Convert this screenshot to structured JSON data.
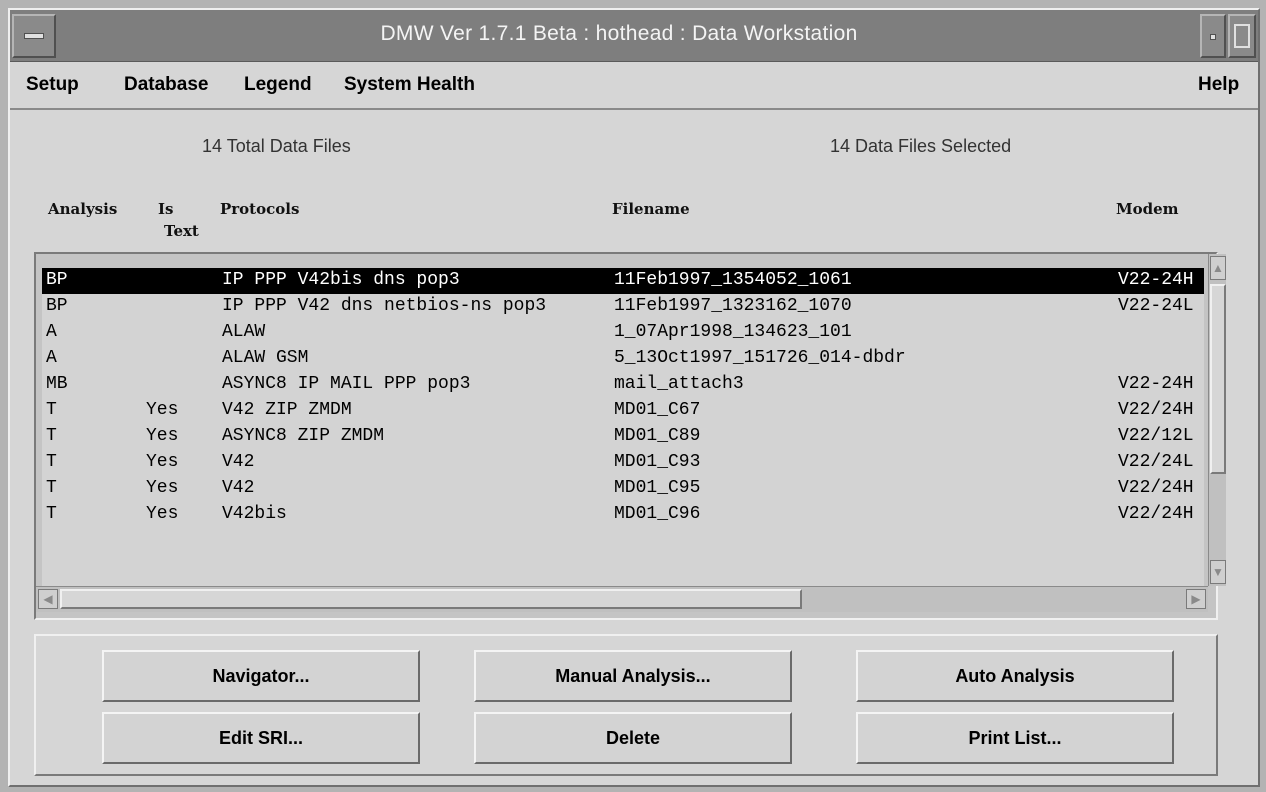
{
  "window": {
    "title": "DMW Ver 1.7.1 Beta : hothead : Data Workstation"
  },
  "menubar": {
    "items": [
      {
        "label": "Setup"
      },
      {
        "label": "Database"
      },
      {
        "label": "Legend"
      },
      {
        "label": "System Health"
      }
    ],
    "help_label": "Help"
  },
  "summary": {
    "total_files": "14 Total Data Files",
    "selected_files": "14 Data Files Selected"
  },
  "table": {
    "headers": {
      "analysis": "Analysis",
      "is_text": "Is",
      "is_text_line2": "Text",
      "protocols": "Protocols",
      "filename": "Filename",
      "modem": "Modem"
    },
    "rows": [
      {
        "analysis": "BP",
        "is_text": "",
        "protocols": "IP PPP V42bis dns pop3",
        "filename": "11Feb1997_1354052_1061",
        "modem": "V22-24H",
        "selected": true
      },
      {
        "analysis": "BP",
        "is_text": "",
        "protocols": "IP PPP V42 dns netbios-ns pop3",
        "filename": "11Feb1997_1323162_1070",
        "modem": "V22-24L",
        "selected": false
      },
      {
        "analysis": "A",
        "is_text": "",
        "protocols": "ALAW",
        "filename": "1_07Apr1998_134623_101",
        "modem": "",
        "selected": false
      },
      {
        "analysis": "A",
        "is_text": "",
        "protocols": "ALAW GSM",
        "filename": "5_13Oct1997_151726_014-dbdr",
        "modem": "",
        "selected": false
      },
      {
        "analysis": "MB",
        "is_text": "",
        "protocols": "ASYNC8 IP MAIL PPP pop3",
        "filename": "mail_attach3",
        "modem": "V22-24H",
        "selected": false
      },
      {
        "analysis": "T",
        "is_text": "Yes",
        "protocols": "V42 ZIP ZMDM",
        "filename": "MD01_C67",
        "modem": "V22/24H",
        "selected": false
      },
      {
        "analysis": "T",
        "is_text": "Yes",
        "protocols": "ASYNC8 ZIP ZMDM",
        "filename": "MD01_C89",
        "modem": "V22/12L",
        "selected": false
      },
      {
        "analysis": "T",
        "is_text": "Yes",
        "protocols": "V42",
        "filename": "MD01_C93",
        "modem": "V22/24L",
        "selected": false
      },
      {
        "analysis": "T",
        "is_text": "Yes",
        "protocols": "V42",
        "filename": "MD01_C95",
        "modem": "V22/24H",
        "selected": false
      },
      {
        "analysis": "T",
        "is_text": "Yes",
        "protocols": "V42bis",
        "filename": "MD01_C96",
        "modem": "V22/24H",
        "selected": false
      }
    ]
  },
  "buttons": {
    "navigator": "Navigator...",
    "manual_analysis": "Manual Analysis...",
    "auto_analysis": "Auto Analysis",
    "edit_sri": "Edit SRI...",
    "delete": "Delete",
    "print_list": "Print List..."
  },
  "icons": {
    "window_menu": "window-menu-icon",
    "minimize": "minimize-icon",
    "maximize": "maximize-icon",
    "scroll_up": "arrow-up-icon",
    "scroll_down": "arrow-down-icon",
    "scroll_left": "arrow-left-icon",
    "scroll_right": "arrow-right-icon"
  },
  "colors": {
    "titlebar": "#7e7e7e",
    "selection": "#000000",
    "background": "#d6d6d6"
  }
}
